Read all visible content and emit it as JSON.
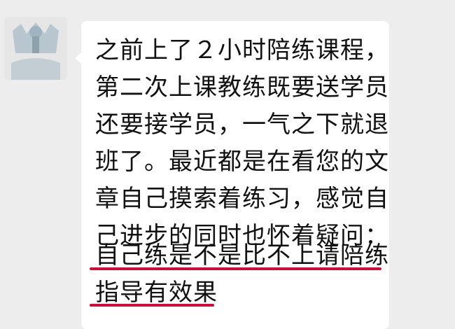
{
  "chat": {
    "avatar_icon": "user-avatar-icon",
    "message": {
      "lines": [
        "之前上了２小时陪练课程，",
        "第二次上课教练既要送学员",
        "还要接学员，一气之下就退",
        "班了。最近都是在看您的文",
        "章自己摸索着练习，感觉自",
        "己进步的同时也怀着疑问：",
        "自己练是不是比不上请陪练",
        "指导有效果"
      ],
      "highlight_color": "#c8103a"
    }
  }
}
